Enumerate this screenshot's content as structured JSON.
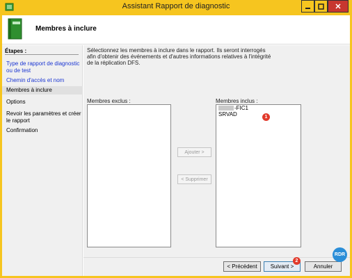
{
  "window": {
    "title": "Assistant Rapport de diagnostic",
    "close_glyph": "✕",
    "minimize_icon": "minimize-icon",
    "maximize_icon": "maximize-icon"
  },
  "header": {
    "title": "Membres à inclure",
    "icon": "book-icon"
  },
  "nav": {
    "heading": "Étapes :",
    "items": [
      {
        "label": "Type de rapport de diagnostic ou de test",
        "state": "link"
      },
      {
        "label": "Chemin d'accès et nom",
        "state": "link"
      },
      {
        "label": "Membres à inclure",
        "state": "current"
      },
      {
        "label": "Options",
        "state": "normal"
      },
      {
        "label": "Revoir les paramètres et créer le rapport",
        "state": "normal"
      },
      {
        "label": "Confirmation",
        "state": "normal"
      }
    ]
  },
  "main": {
    "description": "Sélectionnez les membres à inclure dans le rapport. Ils seront interrogés afin d'obtenir des événements et d'autres informations relatives à l'intégrité de la réplication DFS.",
    "excluded_label": "Membres exclus :",
    "included_label": "Membres inclus :",
    "included_members": [
      "-FIC1",
      "SRVAD"
    ],
    "add_button": "Ajouter >",
    "remove_button": "< Supprimer"
  },
  "footer": {
    "previous_button": "< Précédent",
    "next_button": "Suivant >",
    "cancel_button": "Annuler"
  },
  "annotations": {
    "badge_1": "1",
    "badge_2": "2",
    "watermark": "RDR"
  },
  "colors": {
    "title_bar": "#f6c51f",
    "close_button": "#c7372f",
    "link": "#1a35d2",
    "badge": "#e23a2c",
    "watermark": "#2b8ed8"
  }
}
